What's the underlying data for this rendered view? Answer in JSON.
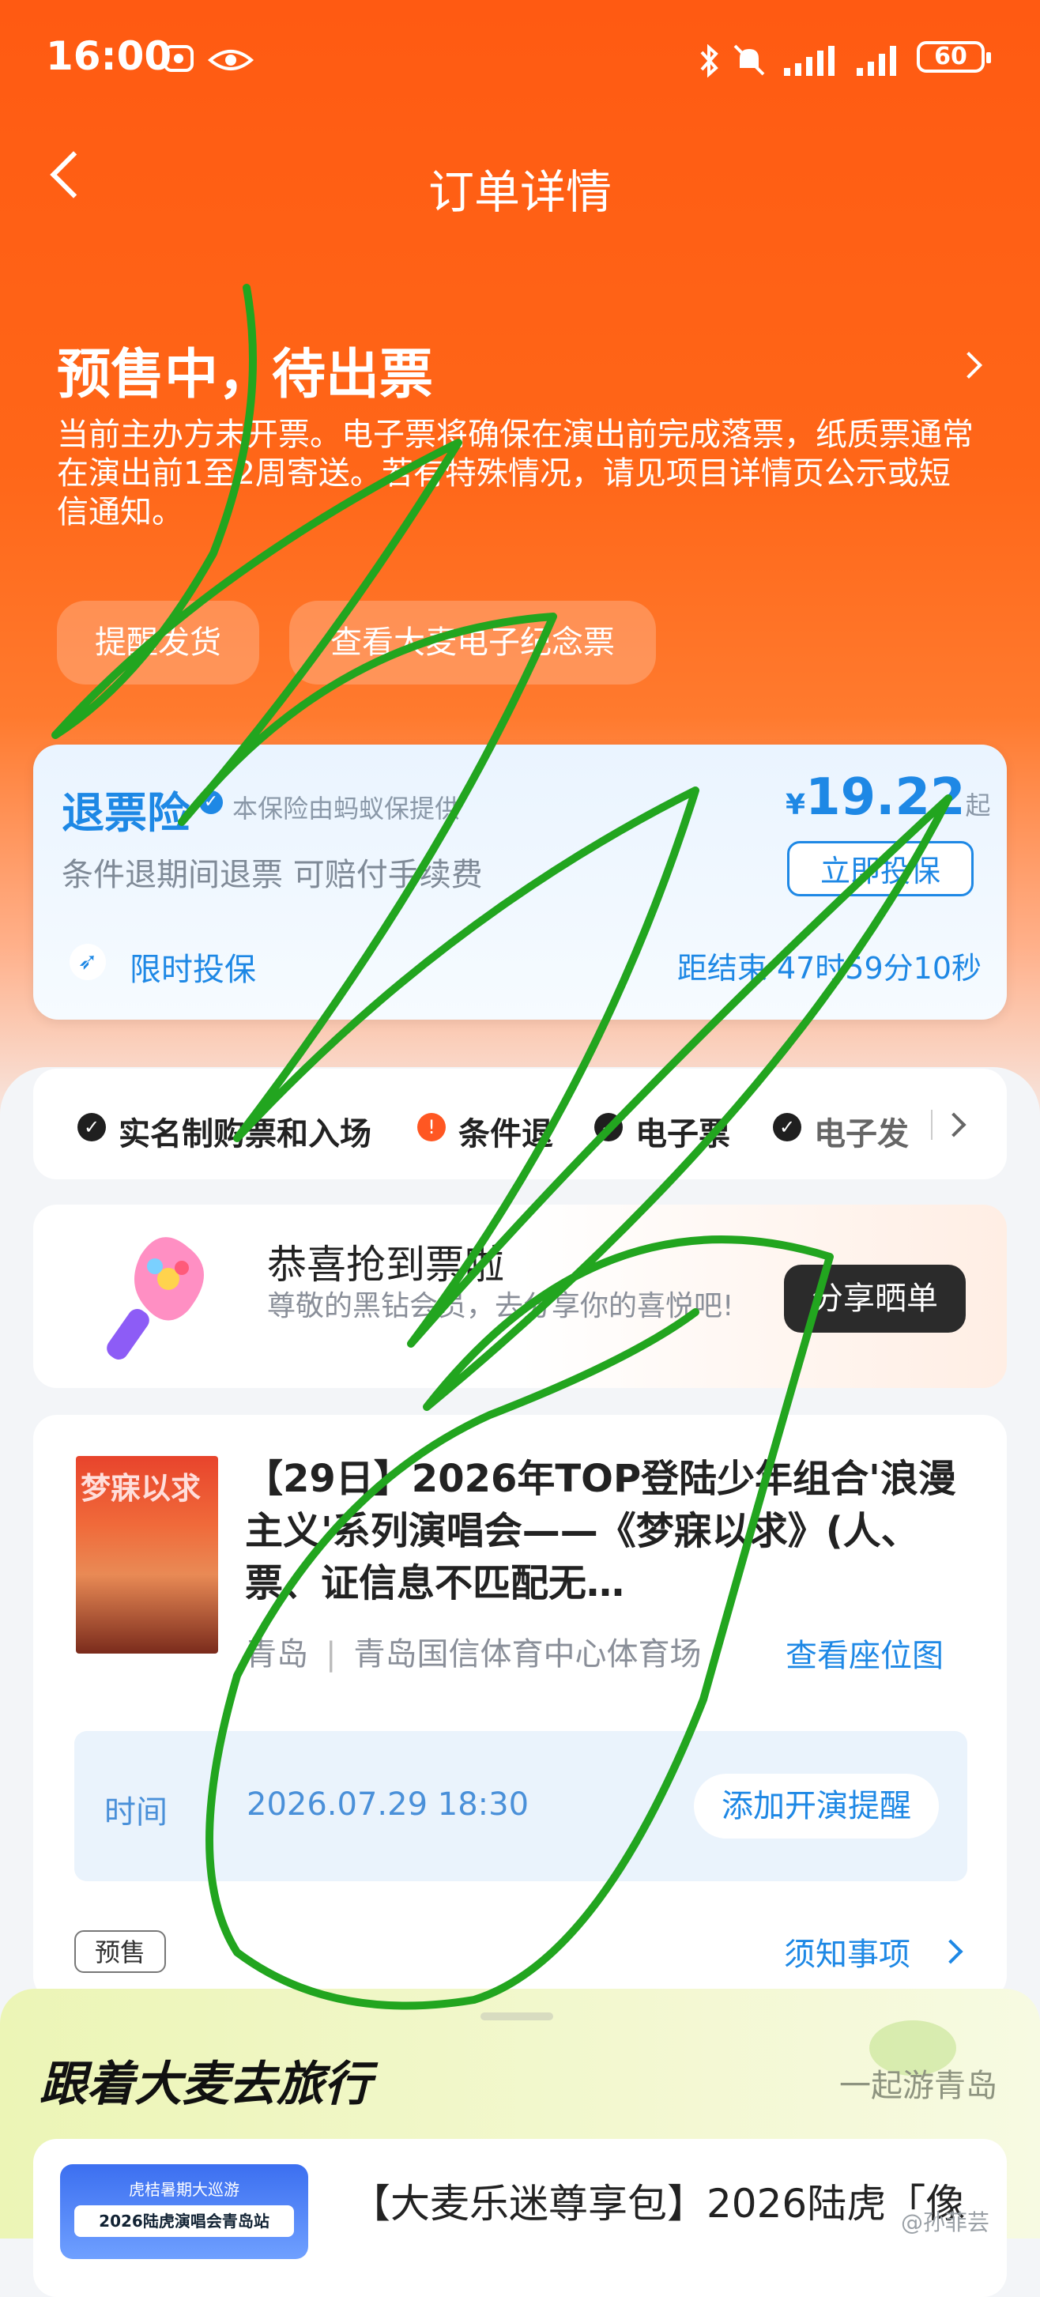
{
  "status_bar": {
    "time": "16:00",
    "battery": "60",
    "icons": [
      "card-icon",
      "eye-icon",
      "bluetooth-icon",
      "mute-icon",
      "signal-icon",
      "signal-icon"
    ]
  },
  "nav": {
    "title": "订单详情"
  },
  "order_status": {
    "title": "预售中，待出票",
    "description": "当前主办方未开票。电子票将确保在演出前完成落票，纸质票通常在演出前1至2周寄送。若有特殊情况，请见项目详情页公示或短信通知。",
    "actions": [
      "提醒发货",
      "查看大麦电子纪念票"
    ]
  },
  "insurance": {
    "name": "退票险",
    "provider": "本保险由蚂蚁保提供",
    "currency": "¥",
    "price": "19.22",
    "price_suffix": "起",
    "subtitle": "条件退期间退票 可赔付手续费",
    "button": "立即投保",
    "limited_label": "限时投保",
    "countdown": "距结束 47时59分10秒"
  },
  "features": [
    "实名制购票和入场",
    "条件退",
    "电子票",
    "电子发"
  ],
  "share": {
    "title": "恭喜抢到票啦",
    "subtitle": "尊敬的黑钻会员，去分享你的喜悦吧!",
    "button": "分享晒单"
  },
  "ticket": {
    "poster_title": "梦寐以求",
    "title": "【29日】2026年TOP登陆少年组合'浪漫主义'系列演唱会——《梦寐以求》(人、票、证信息不匹配无…",
    "city": "青岛",
    "venue": "青岛国信体育中心体育场",
    "seat_map": "查看座位图",
    "time_label": "时间",
    "time_value": "2026.07.29 18:30",
    "reminder": "添加开演提醒",
    "tag": "预售",
    "notes": "须知事项"
  },
  "travel": {
    "title": "跟着大麦去旅行",
    "right": "一起游青岛",
    "thumb_top": "虎桔暑期大巡游",
    "thumb_label": "2026陆虎演唱会青岛站",
    "item_text": "【大麦乐迷尊享包】2026陆虎「像"
  },
  "watermark": "@孙菲芸"
}
